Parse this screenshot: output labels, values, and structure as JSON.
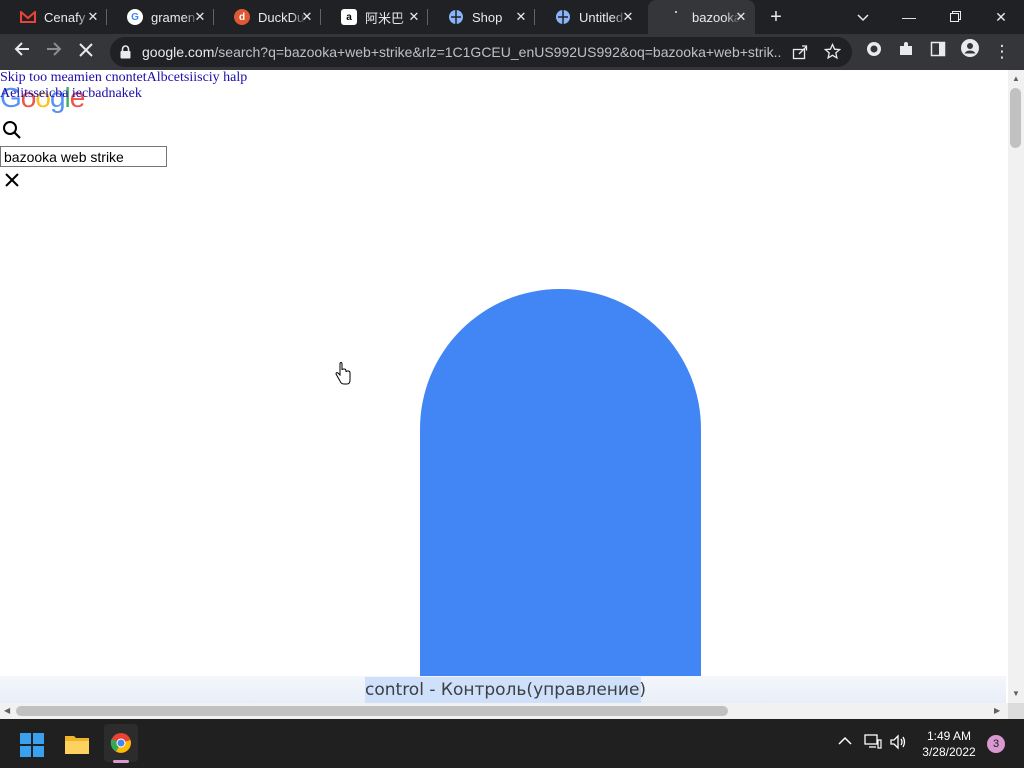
{
  "tabs": [
    {
      "title": "Cenafy",
      "icon": "gmail-icon",
      "color": "#ea4335"
    },
    {
      "title": "gramen",
      "icon": "google-icon",
      "color": "#4285f4"
    },
    {
      "title": "DuckDu",
      "icon": "duckduckgo-icon",
      "color": "#de5833"
    },
    {
      "title": "阿米巴",
      "icon": "amazon-icon",
      "color": "#ffffff"
    },
    {
      "title": "Shop",
      "icon": "web-icon",
      "color": "#8ab4f8"
    },
    {
      "title": "Untitled",
      "icon": "web-icon",
      "color": "#8ab4f8"
    },
    {
      "title": "bazooka",
      "icon": "loading-icon",
      "color": "#e8eaed"
    }
  ],
  "active_tab": 6,
  "address_bar": {
    "host": "google.com",
    "path": "/search?q=bazooka+web+strike&rlz=1C1GCEU_enUS992US992&oq=bazooka+web+strik..."
  },
  "page": {
    "skip_link": "Skip too meamien cnontetAlbcetsiisciy halp",
    "accessibility_link": "Aelitsseicba iecbadnakek",
    "logo": "Google",
    "search_value": "bazooka web strike"
  },
  "translation": {
    "text": "control - Контроль(управление)"
  },
  "taskbar": {
    "time": "1:49 AM",
    "date": "3/28/2022",
    "notification_count": "3"
  },
  "colors": {
    "accent_blue": "#4285f4",
    "tabstrip_bg": "#202124",
    "toolbar_bg": "#35363a",
    "taskbar_bg": "#202020"
  }
}
